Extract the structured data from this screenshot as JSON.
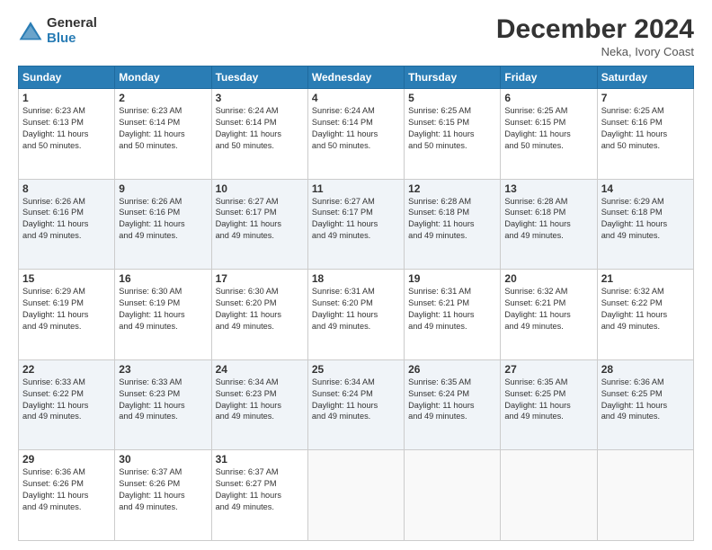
{
  "logo": {
    "general": "General",
    "blue": "Blue"
  },
  "title": "December 2024",
  "subtitle": "Neka, Ivory Coast",
  "weekdays": [
    "Sunday",
    "Monday",
    "Tuesday",
    "Wednesday",
    "Thursday",
    "Friday",
    "Saturday"
  ],
  "weeks": [
    [
      {
        "day": "1",
        "info": "Sunrise: 6:23 AM\nSunset: 6:13 PM\nDaylight: 11 hours\nand 50 minutes."
      },
      {
        "day": "2",
        "info": "Sunrise: 6:23 AM\nSunset: 6:14 PM\nDaylight: 11 hours\nand 50 minutes."
      },
      {
        "day": "3",
        "info": "Sunrise: 6:24 AM\nSunset: 6:14 PM\nDaylight: 11 hours\nand 50 minutes."
      },
      {
        "day": "4",
        "info": "Sunrise: 6:24 AM\nSunset: 6:14 PM\nDaylight: 11 hours\nand 50 minutes."
      },
      {
        "day": "5",
        "info": "Sunrise: 6:25 AM\nSunset: 6:15 PM\nDaylight: 11 hours\nand 50 minutes."
      },
      {
        "day": "6",
        "info": "Sunrise: 6:25 AM\nSunset: 6:15 PM\nDaylight: 11 hours\nand 50 minutes."
      },
      {
        "day": "7",
        "info": "Sunrise: 6:25 AM\nSunset: 6:16 PM\nDaylight: 11 hours\nand 50 minutes."
      }
    ],
    [
      {
        "day": "8",
        "info": "Sunrise: 6:26 AM\nSunset: 6:16 PM\nDaylight: 11 hours\nand 49 minutes."
      },
      {
        "day": "9",
        "info": "Sunrise: 6:26 AM\nSunset: 6:16 PM\nDaylight: 11 hours\nand 49 minutes."
      },
      {
        "day": "10",
        "info": "Sunrise: 6:27 AM\nSunset: 6:17 PM\nDaylight: 11 hours\nand 49 minutes."
      },
      {
        "day": "11",
        "info": "Sunrise: 6:27 AM\nSunset: 6:17 PM\nDaylight: 11 hours\nand 49 minutes."
      },
      {
        "day": "12",
        "info": "Sunrise: 6:28 AM\nSunset: 6:18 PM\nDaylight: 11 hours\nand 49 minutes."
      },
      {
        "day": "13",
        "info": "Sunrise: 6:28 AM\nSunset: 6:18 PM\nDaylight: 11 hours\nand 49 minutes."
      },
      {
        "day": "14",
        "info": "Sunrise: 6:29 AM\nSunset: 6:18 PM\nDaylight: 11 hours\nand 49 minutes."
      }
    ],
    [
      {
        "day": "15",
        "info": "Sunrise: 6:29 AM\nSunset: 6:19 PM\nDaylight: 11 hours\nand 49 minutes."
      },
      {
        "day": "16",
        "info": "Sunrise: 6:30 AM\nSunset: 6:19 PM\nDaylight: 11 hours\nand 49 minutes."
      },
      {
        "day": "17",
        "info": "Sunrise: 6:30 AM\nSunset: 6:20 PM\nDaylight: 11 hours\nand 49 minutes."
      },
      {
        "day": "18",
        "info": "Sunrise: 6:31 AM\nSunset: 6:20 PM\nDaylight: 11 hours\nand 49 minutes."
      },
      {
        "day": "19",
        "info": "Sunrise: 6:31 AM\nSunset: 6:21 PM\nDaylight: 11 hours\nand 49 minutes."
      },
      {
        "day": "20",
        "info": "Sunrise: 6:32 AM\nSunset: 6:21 PM\nDaylight: 11 hours\nand 49 minutes."
      },
      {
        "day": "21",
        "info": "Sunrise: 6:32 AM\nSunset: 6:22 PM\nDaylight: 11 hours\nand 49 minutes."
      }
    ],
    [
      {
        "day": "22",
        "info": "Sunrise: 6:33 AM\nSunset: 6:22 PM\nDaylight: 11 hours\nand 49 minutes."
      },
      {
        "day": "23",
        "info": "Sunrise: 6:33 AM\nSunset: 6:23 PM\nDaylight: 11 hours\nand 49 minutes."
      },
      {
        "day": "24",
        "info": "Sunrise: 6:34 AM\nSunset: 6:23 PM\nDaylight: 11 hours\nand 49 minutes."
      },
      {
        "day": "25",
        "info": "Sunrise: 6:34 AM\nSunset: 6:24 PM\nDaylight: 11 hours\nand 49 minutes."
      },
      {
        "day": "26",
        "info": "Sunrise: 6:35 AM\nSunset: 6:24 PM\nDaylight: 11 hours\nand 49 minutes."
      },
      {
        "day": "27",
        "info": "Sunrise: 6:35 AM\nSunset: 6:25 PM\nDaylight: 11 hours\nand 49 minutes."
      },
      {
        "day": "28",
        "info": "Sunrise: 6:36 AM\nSunset: 6:25 PM\nDaylight: 11 hours\nand 49 minutes."
      }
    ],
    [
      {
        "day": "29",
        "info": "Sunrise: 6:36 AM\nSunset: 6:26 PM\nDaylight: 11 hours\nand 49 minutes."
      },
      {
        "day": "30",
        "info": "Sunrise: 6:37 AM\nSunset: 6:26 PM\nDaylight: 11 hours\nand 49 minutes."
      },
      {
        "day": "31",
        "info": "Sunrise: 6:37 AM\nSunset: 6:27 PM\nDaylight: 11 hours\nand 49 minutes."
      },
      null,
      null,
      null,
      null
    ]
  ]
}
